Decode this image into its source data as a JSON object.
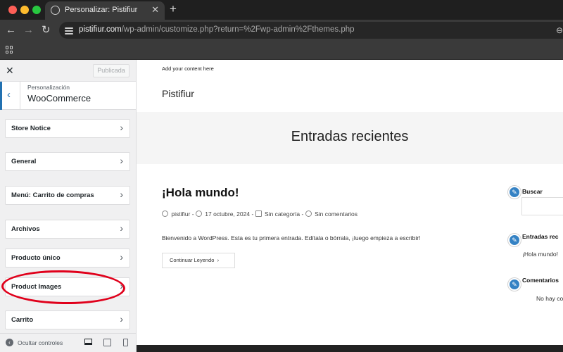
{
  "browser": {
    "tab_title": "Personalizar: Pistifiur",
    "tab_close": "✕",
    "new_tab": "+",
    "url_domain": "pistifiur.com",
    "url_path": "/wp-admin/customize.php?return=%2Fwp-admin%2Fthemes.php",
    "colors": {
      "close": "#fe5f57",
      "minimize": "#febc2e",
      "maximize": "#28c840"
    }
  },
  "sidebar": {
    "close": "✕",
    "published_label": "Publicada",
    "breadcrumb": "Personalización",
    "section_title": "WooCommerce",
    "items": [
      {
        "label": "Store Notice"
      },
      {
        "label": "General"
      },
      {
        "label": "Menú: Carrito de compras"
      },
      {
        "label": "Archivos"
      },
      {
        "label": "Producto único"
      },
      {
        "label": "Product Images"
      },
      {
        "label": "Carrito"
      }
    ],
    "footer": {
      "hide_controls": "Ocultar controles"
    }
  },
  "preview": {
    "add_content": "Add your content here",
    "site_title": "Pistifiur",
    "hero_title": "Entradas recientes",
    "post": {
      "title": "¡Hola mundo!",
      "author": "pistifiur",
      "date": "17 octubre, 2024",
      "category": "Sin categoría",
      "comments": "Sin comentarios",
      "excerpt": "Bienvenido a WordPress. Esta es tu primera entrada. Edítala o bórrala, ¡luego empieza a escribir!",
      "read_more": "Continuar Leyendo"
    },
    "widgets": {
      "search_title": "Buscar",
      "recent_title": "Entradas rec",
      "recent_item": "¡Hola mundo!",
      "comments_title": "Comentarios",
      "comments_text": "No hay co"
    }
  }
}
